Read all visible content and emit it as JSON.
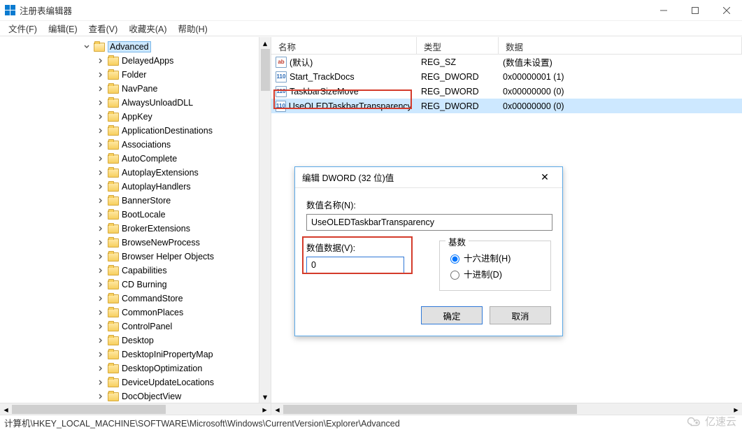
{
  "window": {
    "title": "注册表编辑器",
    "min_icon": "minimize-icon",
    "max_icon": "maximize-icon",
    "close_icon": "close-icon"
  },
  "menu": {
    "file": "文件(F)",
    "edit": "编辑(E)",
    "view": "查看(V)",
    "favorites": "收藏夹(A)",
    "help": "帮助(H)"
  },
  "tree": {
    "selected": "Advanced",
    "children": [
      "DelayedApps",
      "Folder",
      "NavPane",
      "AlwaysUnloadDLL",
      "AppKey",
      "ApplicationDestinations",
      "Associations",
      "AutoComplete",
      "AutoplayExtensions",
      "AutoplayHandlers",
      "BannerStore",
      "BootLocale",
      "BrokerExtensions",
      "BrowseNewProcess",
      "Browser Helper Objects",
      "Capabilities",
      "CD Burning",
      "CommandStore",
      "CommonPlaces",
      "ControlPanel",
      "Desktop",
      "DesktopIniPropertyMap",
      "DesktopOptimization",
      "DeviceUpdateLocations",
      "DocObjectView"
    ]
  },
  "list": {
    "columns": {
      "name": "名称",
      "type": "类型",
      "data": "数据"
    },
    "rows": [
      {
        "icon": "str",
        "name": "(默认)",
        "type": "REG_SZ",
        "data": "(数值未设置)"
      },
      {
        "icon": "dw",
        "name": "Start_TrackDocs",
        "type": "REG_DWORD",
        "data": "0x00000001 (1)"
      },
      {
        "icon": "dw",
        "name": "TaskbarSizeMove",
        "type": "REG_DWORD",
        "data": "0x00000000 (0)"
      },
      {
        "icon": "dw",
        "name": "UseOLEDTaskbarTransparency",
        "type": "REG_DWORD",
        "data": "0x00000000 (0)",
        "selected": true
      }
    ]
  },
  "dialog": {
    "title": "编辑 DWORD (32 位)值",
    "name_label": "数值名称(N):",
    "name_value": "UseOLEDTaskbarTransparency",
    "data_label": "数值数据(V):",
    "data_value": "0",
    "base_label": "基数",
    "hex_label": "十六进制(H)",
    "dec_label": "十进制(D)",
    "ok": "确定",
    "cancel": "取消"
  },
  "statusbar": {
    "path": "计算机\\HKEY_LOCAL_MACHINE\\SOFTWARE\\Microsoft\\Windows\\CurrentVersion\\Explorer\\Advanced"
  },
  "watermark": {
    "text": "亿速云"
  },
  "colors": {
    "accent": "#2f78d7",
    "highlight_border": "#d43b2b",
    "selection": "#cde8ff"
  }
}
